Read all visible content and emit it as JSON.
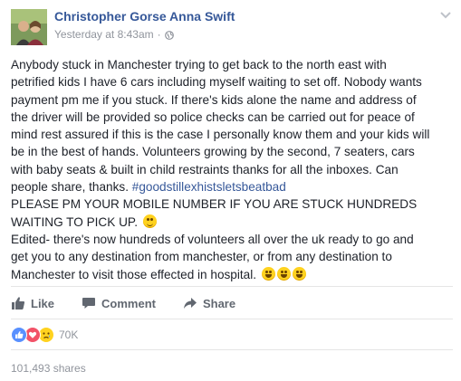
{
  "post": {
    "author": "Christopher Gorse Anna Swift",
    "timestamp": "Yesterday at 8:43am",
    "separator": "·",
    "privacy_icon": "globe-icon",
    "menu_icon": "chevron-down-icon",
    "body_lines": [
      "Anybody stuck in Manchester trying to get back to the north east with",
      "petrified kids I have 6 cars including myself waiting to set off. Nobody wants",
      "payment pm me if you stuck. If there's kids alone the name and address of",
      "the driver will be provided so police checks can be carried out for peace of",
      "mind rest assured if this is the case I personally know them and your kids will",
      "be in the best of hands. Volunteers growing by the second, 7 seaters, cars",
      "with baby seats & built in child restraints thanks for all the inboxes. Can"
    ],
    "line8_text": "people share, thanks. ",
    "hashtag": "#goodstillexhistsletsbeatbad",
    "caps_line1": "PLEASE PM YOUR MOBILE NUMBER IF YOU ARE STUCK HUNDREDS",
    "caps_line2": "WAITING TO PICK UP. ",
    "edit_lines": [
      "Edited- there's now hundreds of volunteers all over the uk ready to go and",
      "get you to any destination from manchester, or from any destination to"
    ],
    "last_line": "Manchester to visit those effected in hospital. "
  },
  "actions": {
    "like_label": "Like",
    "comment_label": "Comment",
    "share_label": "Share"
  },
  "reactions": {
    "icons": [
      "like-icon",
      "love-icon",
      "sad-icon"
    ],
    "count": "70K"
  },
  "shares": "101,493 shares",
  "colors": {
    "author_link": "#365899",
    "meta_text": "#90949c",
    "like_blue": "#5890ff",
    "love_red": "#f25268",
    "emoji_yellow": "#ffd21f"
  }
}
